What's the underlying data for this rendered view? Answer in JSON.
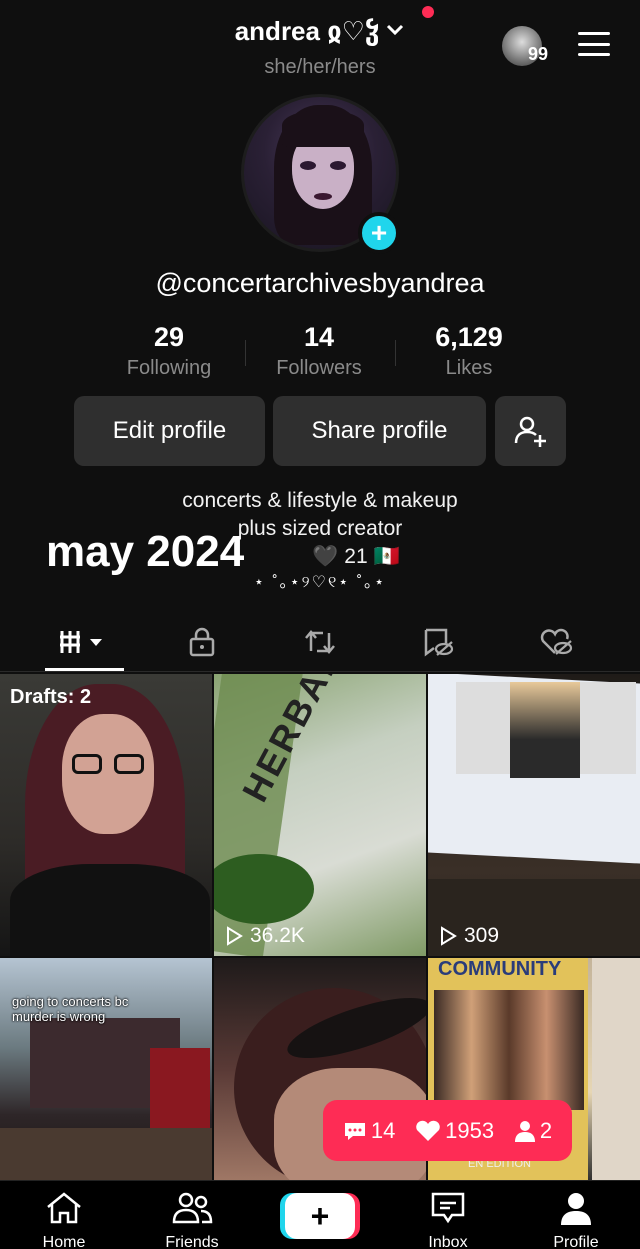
{
  "header": {
    "username": "andrea ჲ♡ჴ",
    "pronouns": "she/her/hers",
    "notification_count": "99"
  },
  "profile": {
    "handle": "@concertarchivesbyandrea",
    "stats": [
      {
        "value": "29",
        "label": "Following"
      },
      {
        "value": "14",
        "label": "Followers"
      },
      {
        "value": "6,129",
        "label": "Likes"
      }
    ],
    "edit_label": "Edit profile",
    "share_label": "Share profile",
    "bio_line1": "concerts & lifestyle & makeup",
    "bio_line2": "plus sized creator",
    "bio_line3": "🖤 21 🇲🇽",
    "bio_deco": "⋆ ˚｡⋆୨♡୧⋆ ˚｡⋆",
    "overlay_caption": "may 2024"
  },
  "tabs": [
    "videos",
    "private",
    "reposts",
    "favorites",
    "liked"
  ],
  "grid": {
    "drafts_label": "Drafts: 2",
    "cell2_views": "36.2K",
    "cell3_views": "309",
    "cell4_caption_line1": "going to concerts bc",
    "cell4_caption_line2": "murder is wrong",
    "herbalife_text": "HERBALIFE",
    "community_text": "COMMUNITY",
    "cell6_footer": "EN EDITION"
  },
  "floatbar": {
    "comments": "14",
    "likes": "1953",
    "followers": "2"
  },
  "nav": {
    "home": "Home",
    "friends": "Friends",
    "inbox": "Inbox",
    "profile": "Profile"
  },
  "colors": {
    "background": "#0f0f0f",
    "accent_red": "#fe2c55",
    "accent_cyan": "#20d5ec",
    "button_bg": "#2f2f2f"
  }
}
